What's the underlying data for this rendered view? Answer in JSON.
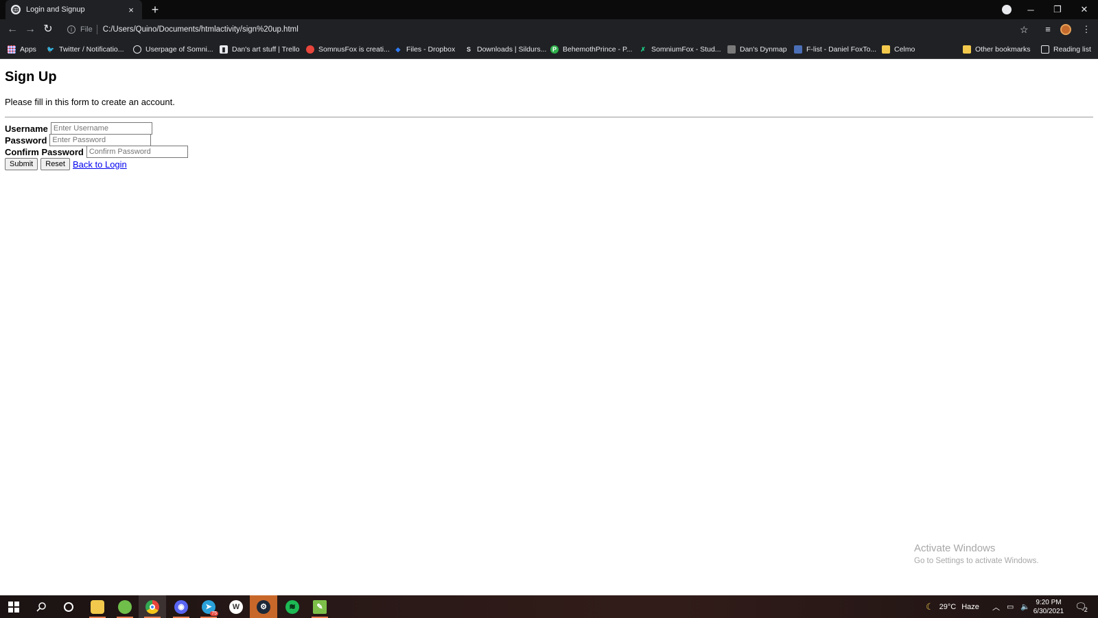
{
  "browser": {
    "tab_title": "Login and Signup",
    "tab_close": "×",
    "new_tab": "+",
    "url_scheme": "File",
    "url": "C:/Users/Quino/Documents/htmlactivity/sign%20up.html",
    "window_controls": {
      "minimize": "─",
      "restore": "❐",
      "close": "✕"
    },
    "bookmarks": [
      {
        "label": "Apps",
        "icon": "apps-grid-icon"
      },
      {
        "label": "Twitter / Notificatio...",
        "icon": "twitter-icon"
      },
      {
        "label": "Userpage of Somni...",
        "icon": "paw-icon"
      },
      {
        "label": "Dan's art stuff | Trello",
        "icon": "trello-icon"
      },
      {
        "label": "SomnusFox is creati...",
        "icon": "patreon-icon"
      },
      {
        "label": "Files - Dropbox",
        "icon": "dropbox-icon"
      },
      {
        "label": "Downloads | Sildurs...",
        "icon": "s-letter-icon"
      },
      {
        "label": "BehemothPrince - P...",
        "icon": "p-circle-icon"
      },
      {
        "label": "SomniumFox - Stud...",
        "icon": "studio-icon"
      },
      {
        "label": "Dan's Dynmap",
        "icon": "cube-icon"
      },
      {
        "label": "F-list - Daniel FoxTo...",
        "icon": "flist-icon"
      },
      {
        "label": "Celmo",
        "icon": "folder-icon"
      }
    ],
    "other_bookmarks": "Other bookmarks",
    "reading_list": "Reading list"
  },
  "page": {
    "heading": "Sign Up",
    "intro": "Please fill in this form to create an account.",
    "fields": {
      "username_label": "Username",
      "username_placeholder": "Enter Username",
      "password_label": "Password",
      "password_placeholder": "Enter Password",
      "confirm_label": "Confirm Password",
      "confirm_placeholder": "Confirm Password"
    },
    "submit_label": "Submit",
    "reset_label": "Reset",
    "back_link": "Back to Login"
  },
  "watermark": {
    "line1": "Activate Windows",
    "line2": "Go to Settings to activate Windows."
  },
  "taskbar": {
    "apps": [
      {
        "name": "start",
        "icon": "windows-logo-icon"
      },
      {
        "name": "search",
        "icon": "search-icon"
      },
      {
        "name": "cortana",
        "icon": "cortana-circle-icon"
      },
      {
        "name": "file-explorer",
        "icon": "folder-icon",
        "color": "#f2c94c"
      },
      {
        "name": "map-app",
        "icon": "map-icon",
        "color": "#6fbf4a"
      },
      {
        "name": "chrome",
        "icon": "chrome-icon",
        "color": "#e8453c"
      },
      {
        "name": "discord",
        "icon": "discord-icon",
        "color": "#5865f2"
      },
      {
        "name": "telegram",
        "icon": "telegram-icon",
        "color": "#2aa1da",
        "badge": "75"
      },
      {
        "name": "wattpad",
        "icon": "w-letter-icon",
        "color": "#ffffff"
      },
      {
        "name": "steam",
        "icon": "steam-icon",
        "color": "#1b2838"
      },
      {
        "name": "spotify",
        "icon": "spotify-icon",
        "color": "#1db954"
      },
      {
        "name": "notes",
        "icon": "notes-icon",
        "color": "#7cc04a"
      }
    ],
    "weather_temp": "29°C",
    "weather_desc": "Haze",
    "time": "9:20 PM",
    "date": "6/30/2021",
    "notification_count": "2"
  }
}
